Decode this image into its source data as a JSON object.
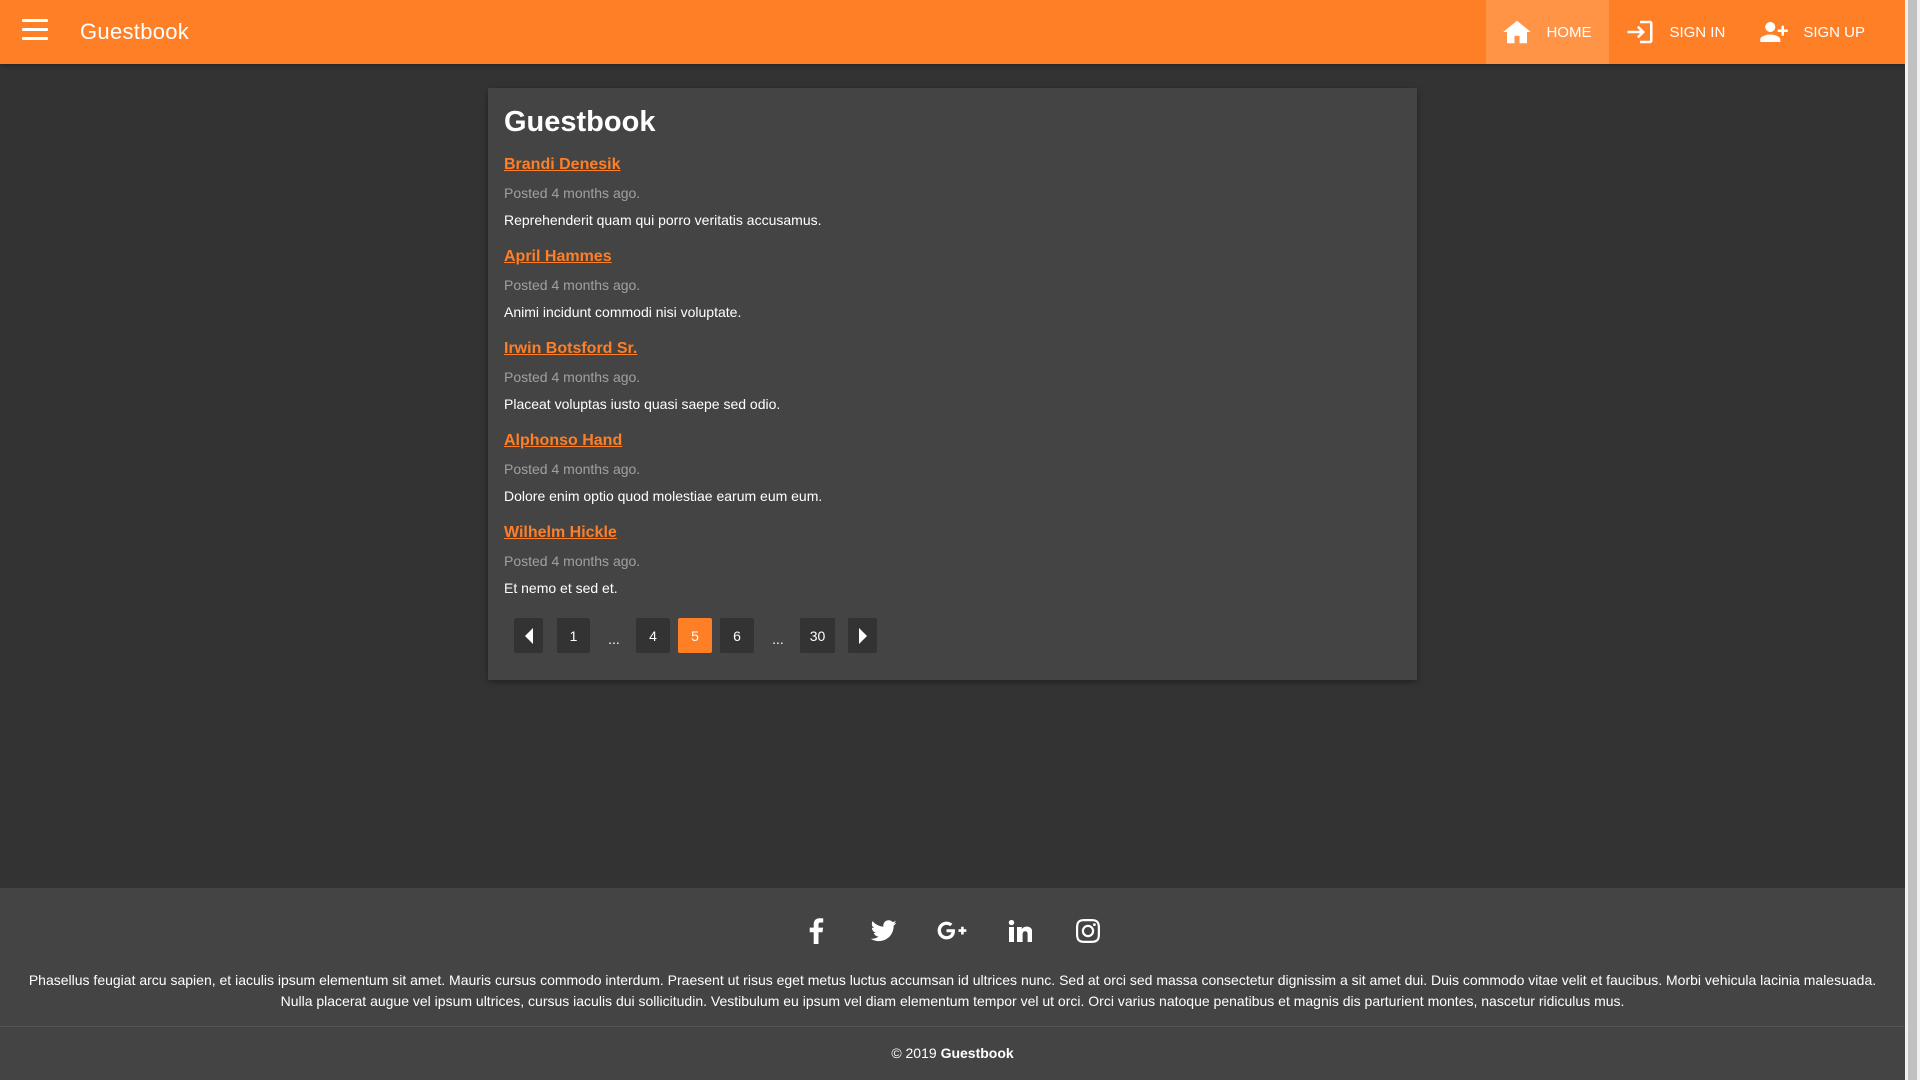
{
  "app": {
    "title": "Guestbook"
  },
  "nav": {
    "home": "HOME",
    "signin": "SIGN IN",
    "signup": "SIGN UP"
  },
  "main": {
    "heading": "Guestbook",
    "entries": [
      {
        "author": "Brandi Denesik",
        "meta": "Posted 4 months ago.",
        "body": "Reprehenderit quam qui porro veritatis accusamus."
      },
      {
        "author": "April Hammes",
        "meta": "Posted 4 months ago.",
        "body": "Animi incidunt commodi nisi voluptate."
      },
      {
        "author": "Irwin Botsford Sr.",
        "meta": "Posted 4 months ago.",
        "body": "Placeat voluptas iusto quasi saepe sed odio."
      },
      {
        "author": "Alphonso Hand",
        "meta": "Posted 4 months ago.",
        "body": "Dolore enim optio quod molestiae earum eum eum."
      },
      {
        "author": "Wilhelm Hickle",
        "meta": "Posted 4 months ago.",
        "body": "Et nemo et sed et."
      }
    ]
  },
  "pagination": {
    "pages": [
      "1",
      "...",
      "4",
      "5",
      "6",
      "...",
      "30"
    ],
    "current": "5"
  },
  "footer": {
    "social": [
      "facebook-icon",
      "twitter-icon",
      "google-plus-icon",
      "linkedin-icon",
      "instagram-icon"
    ],
    "text": "Phasellus feugiat arcu sapien, et iaculis ipsum elementum sit amet. Mauris cursus commodo interdum. Praesent ut risus eget metus luctus accumsan id ultrices nunc. Sed at orci sed massa consectetur dignissim a sit amet dui. Duis commodo vitae velit et faucibus. Morbi vehicula lacinia malesuada. Nulla placerat augue vel ipsum ultrices, cursus iaculis dui sollicitudin. Vestibulum eu ipsum vel diam elementum tempor vel ut orci. Orci varius natoque penatibus et magnis dis parturient montes, nascetur ridiculus mus.",
    "copyright_prefix": "© 2019",
    "copyright_brand": "Guestbook"
  },
  "colors": {
    "accent": "#ff7f27",
    "background": "#333333",
    "card": "#444444"
  }
}
